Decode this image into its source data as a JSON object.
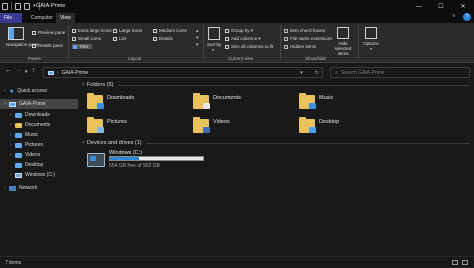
{
  "window": {
    "title": "GAIA-Prime",
    "minimize_glyph": "—",
    "maximize_glyph": "☐",
    "close_glyph": "✕"
  },
  "ribbon_tabs": [
    "File",
    "Computer",
    "View"
  ],
  "ribbon": {
    "panes": {
      "navigation_pane": "Navigation pane",
      "preview_pane": "Preview pane",
      "details_pane": "Details pane",
      "group_label": "Panes"
    },
    "layout": {
      "options": [
        "Extra large icons",
        "Large icons",
        "Medium icons",
        "Small icons",
        "List",
        "Details",
        "Tiles"
      ],
      "selected": "Tiles",
      "group_label": "Layout"
    },
    "current_view": {
      "sort_by": "Sort by",
      "group_by": "Group by",
      "add_columns": "Add columns",
      "size_all_columns": "Size all columns to fit",
      "group_label": "Current view"
    },
    "show_hide": {
      "item_check_boxes": "Item check boxes",
      "file_name_extensions": "File name extensions",
      "hidden_items": "Hidden items",
      "hide_selected_items": "Hide selected items",
      "group_label": "Show/hide"
    },
    "options_label": "Options"
  },
  "address": {
    "path": "GAIA-Prime",
    "search_placeholder": "Search GAIA-Prime"
  },
  "navpane": {
    "quick_access": "Quick access",
    "this_pc": "GAIA-Prime",
    "items": [
      "Downloads",
      "Documents",
      "Music",
      "Pictures",
      "Videos",
      "Desktop",
      "Windows (C:)"
    ],
    "network": "Network"
  },
  "content": {
    "folders_header": "Folders (6)",
    "folders": [
      "Downloads",
      "Documents",
      "Music",
      "Pictures",
      "Videos",
      "Desktop"
    ],
    "drives_header": "Devices and drives (1)",
    "drive": {
      "name": "Windows (C:)",
      "free_text": "654 GB free of 953 GB",
      "used_fraction": 0.31
    }
  },
  "status": {
    "items": "7 items"
  },
  "colors": {
    "accent": "#2e86d8",
    "folder": "#e9c25b",
    "file_tab": "#3a3a92"
  }
}
